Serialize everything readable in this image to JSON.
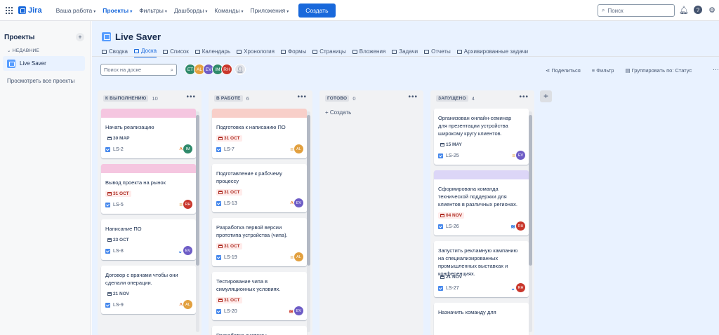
{
  "topbar": {
    "logo": "Jira",
    "nav": [
      {
        "label": "Ваша работа"
      },
      {
        "label": "Проекты",
        "active": true
      },
      {
        "label": "Фильтры"
      },
      {
        "label": "Дашборды"
      },
      {
        "label": "Команды"
      },
      {
        "label": "Приложения"
      }
    ],
    "create_label": "Создать",
    "search_placeholder": "Поиск",
    "help": "?"
  },
  "sidebar": {
    "title": "Проекты",
    "plus": "+",
    "recent_label": "НЕДАВНИЕ",
    "project": "Live Saver",
    "view_all": "Просмотреть все проекты"
  },
  "project": {
    "title": "Live Saver",
    "tabs": [
      "Сводка",
      "Доска",
      "Список",
      "Календарь",
      "Хронология",
      "Формы",
      "Страницы",
      "Вложения",
      "Задачи",
      "Отчеты",
      "Архивированные задачи"
    ],
    "active_tab": 1
  },
  "board": {
    "search_placeholder": "Поиск на доске",
    "avatars": [
      {
        "initials": "ET",
        "color": "#2f8a6b"
      },
      {
        "initials": "AL",
        "color": "#e2a03f"
      },
      {
        "initials": "EV",
        "color": "#6e5dc6"
      },
      {
        "initials": "IM",
        "color": "#2f8a6b"
      },
      {
        "initials": "RH",
        "color": "#c9372c"
      }
    ],
    "share": "Поделиться",
    "filter": "Фильтр",
    "group": "Группировать по: Статус",
    "add_column": "+",
    "more": "•••",
    "columns": [
      {
        "name": "К ВЫПОЛНЕНИЮ",
        "count": "10",
        "cards": [
          {
            "cover": "#f5c6e0",
            "title": "Начать реализацию",
            "due": "30 МАР",
            "overdue": false,
            "key": "LS-2",
            "priority": "^",
            "prio_color": "#e56910",
            "avatar": "IM",
            "av_color": "#2f8a6b"
          },
          {
            "cover": "#f5c6e0",
            "title": "Вывод проекта на рынок",
            "due": "31 ОСТ",
            "overdue": true,
            "key": "LS-5",
            "priority": "=",
            "prio_color": "#e2a03f",
            "avatar": "RH",
            "av_color": "#c9372c"
          },
          {
            "cover": null,
            "title": "Написание ПО",
            "due": "23 ОСТ",
            "overdue": false,
            "key": "LS-8",
            "priority": "⌄",
            "prio_color": "#1868db",
            "avatar": "EV",
            "av_color": "#6e5dc6"
          },
          {
            "cover": null,
            "title": "Договор с врачами чтобы они сделали операции.",
            "due": "21 NOV",
            "overdue": false,
            "key": "LS-9",
            "priority": "^",
            "prio_color": "#e56910",
            "avatar": "AL",
            "av_color": "#e2a03f"
          }
        ]
      },
      {
        "name": "В РАБОТЕ",
        "count": "6",
        "cards": [
          {
            "cover": "#f8cfc9",
            "title": "Подготовка к написанию ПО",
            "due": "31 ОСТ",
            "overdue": true,
            "key": "LS-7",
            "priority": "=",
            "prio_color": "#e2a03f",
            "avatar": "AL",
            "av_color": "#e2a03f"
          },
          {
            "cover": null,
            "title": "Подготавление к рабочему процессу",
            "due": "31 ОСТ",
            "overdue": true,
            "key": "LS-13",
            "priority": "^",
            "prio_color": "#e56910",
            "avatar": "EV",
            "av_color": "#6e5dc6"
          },
          {
            "cover": null,
            "title": "Разработка первой версии прототипа устройства (чипа).",
            "due": "31 ОСТ",
            "overdue": true,
            "key": "LS-19",
            "priority": "=",
            "prio_color": "#e2a03f",
            "avatar": "AL",
            "av_color": "#e2a03f"
          },
          {
            "cover": null,
            "title": "Тестирование чипа в симуляционных условиях.",
            "due": "31 ОСТ",
            "overdue": true,
            "key": "LS-20",
            "priority": "≋",
            "prio_color": "#c9372c",
            "avatar": "EV",
            "av_color": "#6e5dc6"
          },
          {
            "cover": null,
            "title": "Разработка системы",
            "due": null,
            "overdue": false,
            "key": "",
            "priority": "",
            "prio_color": "#44546f",
            "avatar": "",
            "av_color": "#ffffff"
          }
        ]
      },
      {
        "name": "ГОТОВО",
        "count": "0",
        "create": "+ Создать",
        "cards": []
      },
      {
        "name": "ЗАПУЩЕНО",
        "count": "4",
        "cards": [
          {
            "cover": null,
            "title": "Организован онлайн-семинар для презентации устройства широкому кругу клиентов.",
            "due": "15 MAY",
            "overdue": false,
            "key": "LS-25",
            "priority": "=",
            "prio_color": "#e2a03f",
            "avatar": "EV",
            "av_color": "#6e5dc6"
          },
          {
            "cover": "#dcd6f7",
            "title": "Сформирована команда технической поддержки для клиентов в различных регионах.",
            "due": "04 NOV",
            "overdue": true,
            "key": "LS-26",
            "priority": "≋",
            "prio_color": "#1868db",
            "avatar": "RH",
            "av_color": "#c9372c"
          },
          {
            "cover": null,
            "title": "Запустить рекламную кампанию на специализированных промышленных выставках и конференциях.",
            "due": "21 NOV",
            "overdue": false,
            "key": "LS-27",
            "priority": "⌄",
            "prio_color": "#1868db",
            "avatar": "RH",
            "av_color": "#c9372c"
          },
          {
            "cover": null,
            "title": "Назначить команду для",
            "due": null,
            "overdue": false,
            "key": "",
            "priority": "",
            "prio_color": "#44546f",
            "avatar": "",
            "av_color": "#ffffff"
          }
        ]
      }
    ]
  }
}
